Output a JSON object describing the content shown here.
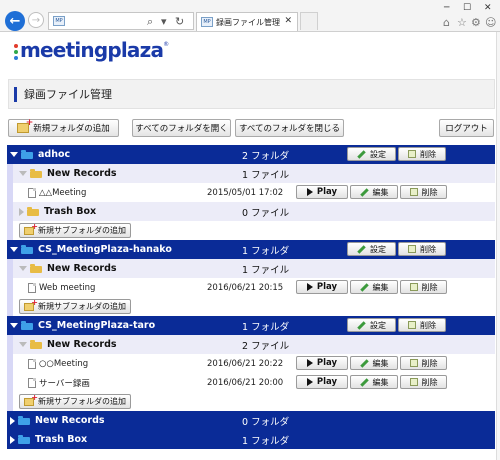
{
  "browser": {
    "tab_title": "録画ファイル管理",
    "tab_favicon": "MP",
    "addr_favicon": "MP",
    "search_glyph": "⌕",
    "dropdown_glyph": "▾",
    "refresh_glyph": "↻",
    "back_glyph": "←",
    "forward_glyph": "→",
    "close_glyph": "✕",
    "minimize_glyph": "─",
    "maximize_glyph": "☐",
    "home_glyph": "⌂",
    "favorites_glyph": "☆",
    "settings_glyph": "⚙",
    "smiley_glyph": "☺"
  },
  "logo": {
    "text": "meetingplaza",
    "reg": "®",
    "dot_colors": [
      "#e23c2c",
      "#2fa84a",
      "#2e7ad6"
    ]
  },
  "page": {
    "title": "録画ファイル管理"
  },
  "toolbar": {
    "add_folder": "新規フォルダの追加",
    "open_all": "すべてのフォルダを開く",
    "close_all": "すべてのフォルダを閉じる",
    "logout": "ログアウト"
  },
  "labels": {
    "settings": "設定",
    "delete": "削除",
    "edit": "編集",
    "play": "Play",
    "add_subfolder": "新規サブフォルダの追加"
  },
  "tree": [
    {
      "name": "adhoc",
      "count": "2 フォルダ",
      "children": [
        {
          "name": "New Records",
          "count": "1 ファイル",
          "files": [
            {
              "name": "△△Meeting",
              "date": "2015/05/01 17:02"
            }
          ]
        },
        {
          "name": "Trash Box",
          "count": "0 ファイル",
          "files": []
        }
      ]
    },
    {
      "name": "CS_MeetingPlaza-hanako",
      "count": "1 フォルダ",
      "children": [
        {
          "name": "New Records",
          "count": "1 ファイル",
          "files": [
            {
              "name": "Web meeting",
              "date": "2016/06/21 20:15"
            }
          ]
        }
      ]
    },
    {
      "name": "CS_MeetingPlaza-taro",
      "count": "1 フォルダ",
      "children": [
        {
          "name": "New Records",
          "count": "2 ファイル",
          "files": [
            {
              "name": "○○Meeting",
              "date": "2016/06/21 20:22"
            },
            {
              "name": "サーバー録画",
              "date": "2016/06/21 20:00"
            }
          ]
        }
      ]
    },
    {
      "name": "New Records",
      "count": "0 フォルダ",
      "collapsed": true
    },
    {
      "name": "Trash Box",
      "count": "1 フォルダ",
      "collapsed": true
    }
  ],
  "colors": {
    "top_row": "#0a2b97",
    "sub_row": "#ececf8",
    "brand": "#1a3aa8"
  }
}
